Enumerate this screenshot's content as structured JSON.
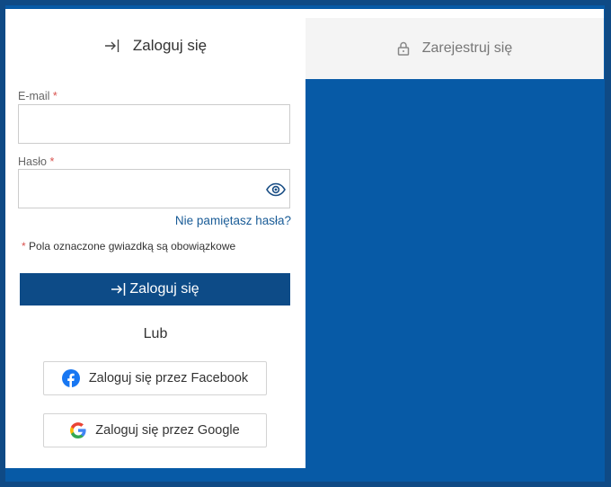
{
  "tabs": {
    "login_label": "Zaloguj się",
    "register_label": "Zarejestruj się"
  },
  "form": {
    "email_label": "E-mail",
    "email_value": "",
    "password_label": "Hasło",
    "password_value": "",
    "required_marker": "*",
    "forgot_password": "Nie pamiętasz hasła?",
    "required_note": "Pola oznaczone gwiazdką są obowiązkowe",
    "submit_label": "Zaloguj się"
  },
  "divider": {
    "or_label": "Lub"
  },
  "social": {
    "facebook_label": "Zaloguj się przez Facebook",
    "google_label": "Zaloguj się przez Google"
  },
  "colors": {
    "brand_blue": "#0d4b87",
    "background_blue": "#075aa6",
    "link_blue": "#1a5c97",
    "required_red": "#d9534f"
  },
  "icons": {
    "login_tab": "sign-in-arrow-icon",
    "register_tab": "lock-icon",
    "password_toggle": "eye-icon",
    "submit": "sign-in-arrow-icon",
    "facebook": "facebook-icon",
    "google": "google-icon"
  }
}
